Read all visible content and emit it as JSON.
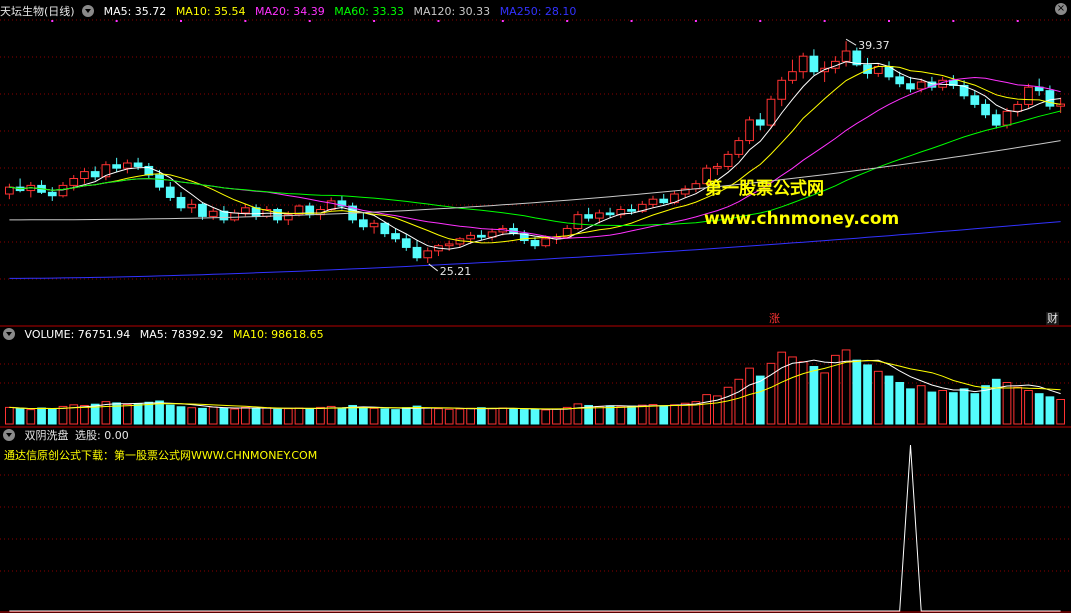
{
  "main_panel": {
    "stock_label": "天坛生物(日线)",
    "indicators": [
      {
        "label": "MA5: 35.72",
        "color": "#ffffff"
      },
      {
        "label": "MA10: 35.54",
        "color": "#ffff00"
      },
      {
        "label": "MA20: 34.39",
        "color": "#ff32ff"
      },
      {
        "label": "MA60: 33.33",
        "color": "#00ff00"
      },
      {
        "label": "MA120: 30.33",
        "color": "#c8c8c8"
      },
      {
        "label": "MA250: 28.10",
        "color": "#3232ff"
      }
    ],
    "high_annotation": "39.37",
    "low_annotation": "25.21",
    "watermark_cn": "第一股票公式网",
    "watermark_url": "www.chnmoney.com",
    "event_marker_zhang": "涨",
    "event_marker_cai": "财",
    "close_icon": "close-icon"
  },
  "volume_panel": {
    "indicators": [
      {
        "label": "VOLUME: 76751.94",
        "color": "#ffffff"
      },
      {
        "label": "MA5: 78392.92",
        "color": "#ffffff"
      },
      {
        "label": "MA10: 98618.65",
        "color": "#ffff00"
      }
    ]
  },
  "signal_panel": {
    "title": "双阴洗盘",
    "value": "选股: 0.00",
    "promo": "通达信原创公式下载：第一股票公式网WWW.CHNMONEY.COM"
  },
  "colors": {
    "up": "#ff3232",
    "down": "#54fcfc",
    "grid": "#8b0000",
    "separator": "#b40000",
    "ma5": "#ffffff",
    "ma10": "#ffff00",
    "ma20": "#ff32ff",
    "ma60": "#00ff00",
    "ma120": "#c8c8c8",
    "ma250": "#3232ff",
    "signal": "#ffffff"
  },
  "chart_data": {
    "type": "candlestick",
    "price_range": [
      24.0,
      40.6
    ],
    "bars": 99,
    "ohlc": [
      [
        30.5,
        31.1,
        30.2,
        30.9
      ],
      [
        30.9,
        31.4,
        30.6,
        30.7
      ],
      [
        30.7,
        31.2,
        30.3,
        31.0
      ],
      [
        31.0,
        31.3,
        30.5,
        30.6
      ],
      [
        30.6,
        30.9,
        30.1,
        30.4
      ],
      [
        30.4,
        31.2,
        30.3,
        31.0
      ],
      [
        31.0,
        31.6,
        30.7,
        31.4
      ],
      [
        31.4,
        32.0,
        31.1,
        31.8
      ],
      [
        31.8,
        32.1,
        31.3,
        31.5
      ],
      [
        31.5,
        32.4,
        31.3,
        32.2
      ],
      [
        32.2,
        32.6,
        31.8,
        32.0
      ],
      [
        32.0,
        32.5,
        31.7,
        32.3
      ],
      [
        32.3,
        32.6,
        31.9,
        32.1
      ],
      [
        32.1,
        32.3,
        31.4,
        31.6
      ],
      [
        31.6,
        31.9,
        30.7,
        30.9
      ],
      [
        30.9,
        31.2,
        30.1,
        30.3
      ],
      [
        30.3,
        30.6,
        29.5,
        29.7
      ],
      [
        29.7,
        30.2,
        29.4,
        29.9
      ],
      [
        29.9,
        30.0,
        29.0,
        29.2
      ],
      [
        29.2,
        29.7,
        29.0,
        29.5
      ],
      [
        29.5,
        29.8,
        28.8,
        29.0
      ],
      [
        29.0,
        29.6,
        28.9,
        29.4
      ],
      [
        29.4,
        29.9,
        29.2,
        29.7
      ],
      [
        29.7,
        29.9,
        29.0,
        29.2
      ],
      [
        29.2,
        29.8,
        29.1,
        29.6
      ],
      [
        29.6,
        29.7,
        28.8,
        29.0
      ],
      [
        29.0,
        29.5,
        28.7,
        29.3
      ],
      [
        29.3,
        29.9,
        29.2,
        29.8
      ],
      [
        29.8,
        30.0,
        29.1,
        29.3
      ],
      [
        29.3,
        29.8,
        29.0,
        29.6
      ],
      [
        29.6,
        30.3,
        29.5,
        30.1
      ],
      [
        30.1,
        30.4,
        29.6,
        29.8
      ],
      [
        29.8,
        30.0,
        28.8,
        29.0
      ],
      [
        29.0,
        29.4,
        28.4,
        28.6
      ],
      [
        28.6,
        29.0,
        28.2,
        28.8
      ],
      [
        28.8,
        28.9,
        28.0,
        28.2
      ],
      [
        28.2,
        28.5,
        27.7,
        27.9
      ],
      [
        27.9,
        28.2,
        27.2,
        27.4
      ],
      [
        27.4,
        27.8,
        26.6,
        26.8
      ],
      [
        26.8,
        27.4,
        26.5,
        27.2
      ],
      [
        27.2,
        27.6,
        26.9,
        27.5
      ],
      [
        27.5,
        27.8,
        27.2,
        27.6
      ],
      [
        27.6,
        28.0,
        27.4,
        27.9
      ],
      [
        27.9,
        28.3,
        27.6,
        28.1
      ],
      [
        28.1,
        28.4,
        27.8,
        28.0
      ],
      [
        28.0,
        28.5,
        27.8,
        28.3
      ],
      [
        28.3,
        28.7,
        28.1,
        28.5
      ],
      [
        28.5,
        28.8,
        28.1,
        28.2
      ],
      [
        28.2,
        28.4,
        27.6,
        27.8
      ],
      [
        27.8,
        28.0,
        27.3,
        27.5
      ],
      [
        27.5,
        28.1,
        27.4,
        27.9
      ],
      [
        27.9,
        28.2,
        27.6,
        28.0
      ],
      [
        28.0,
        28.7,
        27.9,
        28.5
      ],
      [
        28.5,
        29.5,
        28.4,
        29.3
      ],
      [
        29.3,
        29.7,
        28.9,
        29.1
      ],
      [
        29.1,
        29.6,
        28.8,
        29.4
      ],
      [
        29.4,
        29.7,
        29.1,
        29.3
      ],
      [
        29.3,
        29.8,
        29.1,
        29.6
      ],
      [
        29.6,
        29.9,
        29.3,
        29.5
      ],
      [
        29.5,
        30.1,
        29.4,
        29.9
      ],
      [
        29.9,
        30.4,
        29.7,
        30.2
      ],
      [
        30.2,
        30.5,
        29.9,
        30.0
      ],
      [
        30.0,
        30.7,
        29.9,
        30.5
      ],
      [
        30.5,
        31.0,
        30.3,
        30.8
      ],
      [
        30.8,
        31.3,
        30.6,
        31.1
      ],
      [
        31.1,
        32.2,
        31.0,
        32.0
      ],
      [
        32.0,
        32.3,
        31.6,
        32.1
      ],
      [
        32.1,
        33.0,
        31.9,
        32.8
      ],
      [
        32.8,
        33.8,
        32.6,
        33.6
      ],
      [
        33.6,
        35.0,
        33.4,
        34.8
      ],
      [
        34.8,
        35.2,
        34.2,
        34.5
      ],
      [
        34.5,
        36.2,
        34.3,
        36.0
      ],
      [
        36.0,
        37.3,
        35.6,
        37.1
      ],
      [
        37.1,
        38.3,
        36.9,
        37.6
      ],
      [
        37.6,
        38.7,
        37.2,
        38.5
      ],
      [
        38.5,
        38.9,
        37.4,
        37.6
      ],
      [
        37.6,
        38.2,
        37.0,
        37.8
      ],
      [
        37.8,
        38.5,
        37.5,
        38.2
      ],
      [
        38.2,
        39.37,
        37.9,
        38.8
      ],
      [
        38.8,
        39.0,
        37.9,
        38.0
      ],
      [
        38.0,
        38.4,
        37.2,
        37.5
      ],
      [
        37.5,
        38.1,
        37.3,
        37.9
      ],
      [
        37.9,
        38.2,
        37.1,
        37.3
      ],
      [
        37.3,
        37.6,
        36.7,
        36.9
      ],
      [
        36.9,
        37.3,
        36.4,
        36.6
      ],
      [
        36.6,
        37.2,
        36.4,
        37.0
      ],
      [
        37.0,
        37.3,
        36.5,
        36.7
      ],
      [
        36.7,
        37.3,
        36.5,
        37.1
      ],
      [
        37.1,
        37.4,
        36.6,
        36.8
      ],
      [
        36.8,
        37.1,
        36.0,
        36.2
      ],
      [
        36.2,
        36.5,
        35.5,
        35.7
      ],
      [
        35.7,
        36.0,
        34.9,
        35.1
      ],
      [
        35.1,
        35.4,
        34.3,
        34.5
      ],
      [
        34.5,
        35.5,
        34.3,
        35.3
      ],
      [
        35.3,
        35.9,
        35.0,
        35.7
      ],
      [
        35.7,
        36.9,
        35.5,
        36.7
      ],
      [
        36.7,
        37.2,
        36.2,
        36.5
      ],
      [
        36.5,
        36.8,
        35.4,
        35.6
      ],
      [
        35.6,
        36.1,
        35.2,
        35.72
      ]
    ],
    "volume": [
      52000,
      48000,
      45000,
      50000,
      47000,
      55000,
      60000,
      58000,
      62000,
      70000,
      66000,
      61000,
      64000,
      68000,
      72000,
      59000,
      54000,
      51000,
      49000,
      53000,
      50000,
      47000,
      52000,
      49000,
      51000,
      46000,
      48000,
      50000,
      47000,
      52000,
      55000,
      50000,
      58000,
      53000,
      49000,
      47000,
      45000,
      51000,
      56000,
      50000,
      48000,
      46000,
      47000,
      49000,
      51000,
      48000,
      50000,
      47000,
      45000,
      46000,
      44000,
      47000,
      52000,
      63000,
      58000,
      55000,
      57000,
      54000,
      56000,
      59000,
      61000,
      57000,
      60000,
      65000,
      70000,
      92000,
      88000,
      115000,
      140000,
      175000,
      150000,
      190000,
      225000,
      210000,
      195000,
      180000,
      160000,
      215000,
      232000,
      200000,
      185000,
      165000,
      150000,
      130000,
      110000,
      120000,
      100000,
      105000,
      98000,
      110000,
      95000,
      120000,
      140000,
      130000,
      115000,
      105000,
      95000,
      85000,
      76751.94
    ],
    "signal_spike_bar": 84,
    "signal_spike_value": 1
  }
}
